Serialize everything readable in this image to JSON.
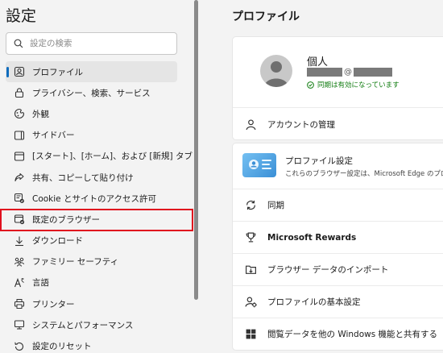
{
  "sidebar": {
    "title": "設定",
    "search_placeholder": "設定の検索",
    "items": [
      {
        "label": "プロファイル",
        "icon": "profile-icon",
        "selected": true
      },
      {
        "label": "プライバシー、検索、サービス",
        "icon": "lock-icon"
      },
      {
        "label": "外観",
        "icon": "appearance-icon"
      },
      {
        "label": "サイドバー",
        "icon": "sidebar-icon"
      },
      {
        "label": "[スタート]、[ホーム]、および [新規] タブ",
        "icon": "home-tab-icon"
      },
      {
        "label": "共有、コピーして貼り付け",
        "icon": "share-icon"
      },
      {
        "label": "Cookie とサイトのアクセス許可",
        "icon": "cookie-icon"
      },
      {
        "label": "既定のブラウザー",
        "icon": "default-browser-icon",
        "highlighted": true
      },
      {
        "label": "ダウンロード",
        "icon": "download-icon"
      },
      {
        "label": "ファミリー セーフティ",
        "icon": "family-icon"
      },
      {
        "label": "言語",
        "icon": "language-icon"
      },
      {
        "label": "プリンター",
        "icon": "printer-icon"
      },
      {
        "label": "システムとパフォーマンス",
        "icon": "system-icon"
      },
      {
        "label": "設定のリセット",
        "icon": "reset-icon"
      }
    ],
    "highlight_color": "#e0101e",
    "accent_color": "#0f6cbd"
  },
  "main": {
    "title": "プロファイル",
    "profile": {
      "name": "個人",
      "email_at": "@",
      "sync_status": "同期は有効になっています",
      "sync_color": "#107c10"
    },
    "manage_account": "アカウントの管理",
    "profile_settings": {
      "title": "プロファイル設定",
      "description": "これらのブラウザー設定は、Microsoft Edge のプロフ"
    },
    "rows": [
      {
        "label": "同期",
        "icon": "sync-icon"
      },
      {
        "label": "Microsoft Rewards",
        "icon": "trophy-icon"
      },
      {
        "label": "ブラウザー データのインポート",
        "icon": "import-icon"
      },
      {
        "label": "プロファイルの基本設定",
        "icon": "profile-prefs-icon"
      },
      {
        "label": "閲覧データを他の Windows 機能と共有する",
        "icon": "windows-icon"
      }
    ]
  }
}
